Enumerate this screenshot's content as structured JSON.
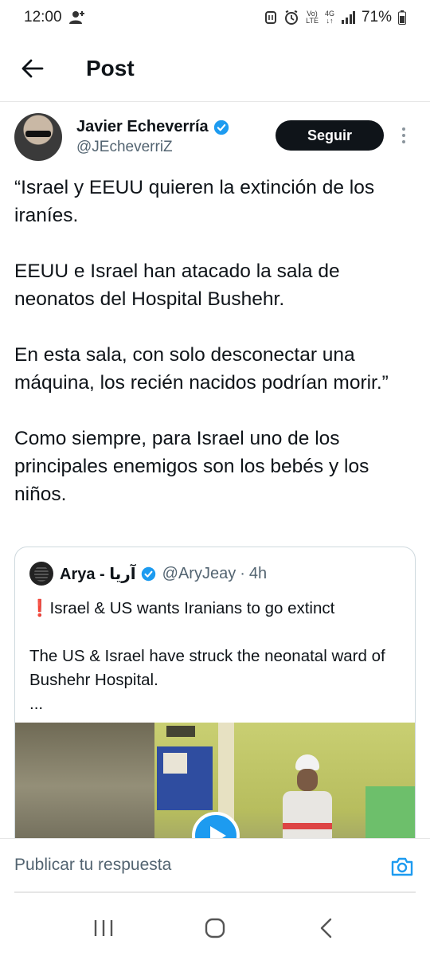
{
  "status_bar": {
    "time": "12:00",
    "battery": "71%",
    "network_label_top": "Vo)",
    "network_label_bottom": "LTE",
    "network_type": "4G",
    "icons": [
      "person-add-icon",
      "nfc-icon",
      "alarm-icon",
      "volte-icon",
      "signal-icon",
      "battery-icon"
    ]
  },
  "header": {
    "title": "Post",
    "back_icon": "arrow-left-icon"
  },
  "author": {
    "name": "Javier Echeverría",
    "handle": "@JEcheverriZ",
    "verified": true,
    "follow_label": "Seguir"
  },
  "tweet": {
    "paragraphs": [
      "“Israel y EEUU quieren la extinción de los iraníes.",
      "EEUU e Israel han atacado la sala de neonatos del Hospital Bushehr.",
      "En esta sala, con solo desconectar una máquina, los recién nacidos podrían morir.”",
      "Como siempre, para Israel uno de los principales enemigos son los bebés y los niños."
    ]
  },
  "quote": {
    "name": "Arya - آريا",
    "verified": true,
    "handle": "@AryJeay",
    "time": "4h",
    "line1_icon": "❗",
    "line1": "Israel & US wants Iranians to go extinct",
    "line2": "The US & Israel have struck the neonatal ward of Bushehr Hospital.",
    "line3": "...",
    "media_type": "video"
  },
  "reply": {
    "placeholder": "Publicar tu respuesta"
  },
  "colors": {
    "accent": "#1d9bf0",
    "text": "#0f1419",
    "muted": "#536471",
    "follow_bg": "#0f1419",
    "border": "#cfd9de"
  },
  "nav": {
    "icons": [
      "recent-apps-icon",
      "home-icon",
      "back-icon"
    ]
  }
}
